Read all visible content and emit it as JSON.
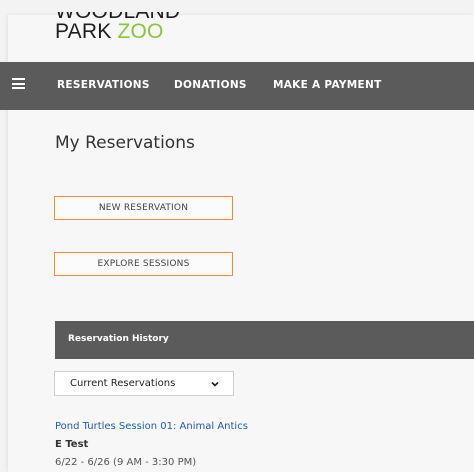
{
  "logo": {
    "line1": "WOODLAND",
    "line2_park": "PARK ",
    "line2_zoo": "ZOO"
  },
  "nav": {
    "menu_icon": "hamburger-icon",
    "items": [
      {
        "label": "RESERVATIONS"
      },
      {
        "label": "DONATIONS"
      },
      {
        "label": "MAKE A PAYMENT"
      }
    ]
  },
  "main": {
    "title": "My Reservations",
    "new_reservation_label": "NEW RESERVATION",
    "explore_sessions_label": "EXPLORE SESSIONS"
  },
  "history": {
    "header": "Reservation History",
    "filter_selected": "Current Reservations",
    "reservations": [
      {
        "title": "Pond Turtles Session 01: Animal Antics",
        "name": "E Test",
        "dates": "6/22 - 6/26 (9 AM - 3:30 PM)"
      }
    ]
  },
  "colors": {
    "nav_bg": "#5b5b5b",
    "accent_orange": "#f08a3c",
    "zoo_green": "#8bc53f",
    "link_blue": "#1f5fa0"
  }
}
